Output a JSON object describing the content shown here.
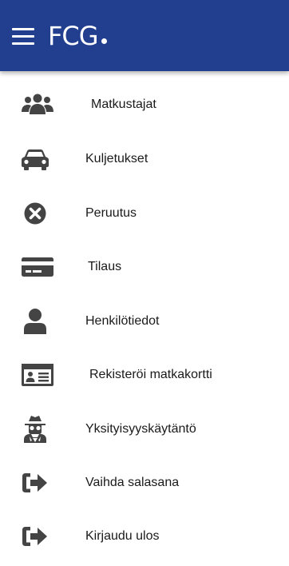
{
  "header": {
    "logo_text": "FCG",
    "menu_icon": "hamburger-icon",
    "background_color": "#223e8f"
  },
  "menu": {
    "icon_color": "#444444",
    "items": [
      {
        "label": "Matkustajat",
        "icon": "users-icon"
      },
      {
        "label": "Kuljetukset",
        "icon": "taxi-icon"
      },
      {
        "label": "Peruutus",
        "icon": "cancel-circle-icon"
      },
      {
        "label": "Tilaus",
        "icon": "credit-card-icon"
      },
      {
        "label": "Henkilötiedot",
        "icon": "user-icon"
      },
      {
        "label": "Rekisteröi matkakortti",
        "icon": "id-card-icon"
      },
      {
        "label": "Yksityisyyskäytäntö",
        "icon": "user-secret-icon"
      },
      {
        "label": "Vaihda salasana",
        "icon": "sign-out-icon"
      },
      {
        "label": "Kirjaudu ulos",
        "icon": "sign-out-icon"
      }
    ]
  }
}
